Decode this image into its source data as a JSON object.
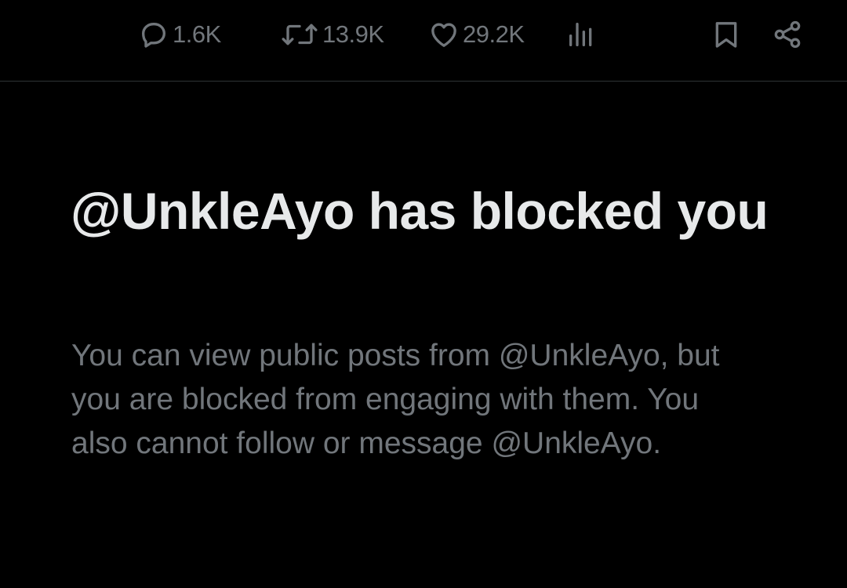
{
  "post_actions": {
    "reply": {
      "icon": "reply-icon",
      "count": "1.6K"
    },
    "repost": {
      "icon": "repost-icon",
      "count": "13.9K"
    },
    "like": {
      "icon": "heart-icon",
      "count": "29.2K"
    },
    "views": {
      "icon": "views-icon"
    },
    "bookmark": {
      "icon": "bookmark-icon"
    },
    "share": {
      "icon": "share-icon"
    }
  },
  "blocked_notice": {
    "title": "@UnkleAyo has blocked you",
    "description": "You can view public posts from @UnkleAyo, but you are blocked from engaging with them. You also cannot follow or message @UnkleAyo."
  },
  "colors": {
    "background": "#000000",
    "primary_text": "#e7e9ea",
    "secondary_text": "#71767b",
    "divider": "#2f3336"
  }
}
